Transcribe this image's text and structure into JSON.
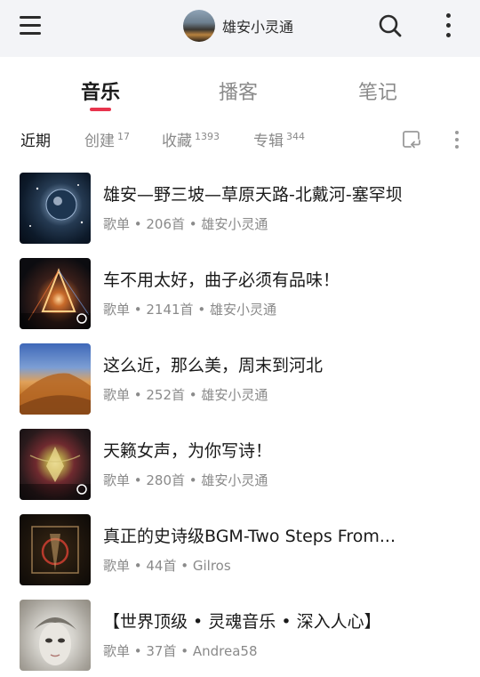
{
  "header": {
    "menu_icon": "hamburger-menu-icon",
    "username": "雄安小灵通",
    "search_icon": "search-icon",
    "more_icon": "more-vertical-icon"
  },
  "tabs": [
    {
      "label": "音乐",
      "active": true
    },
    {
      "label": "播客",
      "active": false
    },
    {
      "label": "笔记",
      "active": false
    }
  ],
  "accent_color": "#e8344d",
  "subtabs": [
    {
      "label": "近期",
      "count": "",
      "active": true
    },
    {
      "label": "创建",
      "count": "17",
      "active": false
    },
    {
      "label": "收藏",
      "count": "1393",
      "active": false
    },
    {
      "label": "专辑",
      "count": "344",
      "active": false
    }
  ],
  "subtab_icons": {
    "import": "import-playlist-icon",
    "more": "more-vertical-icon"
  },
  "playlists": [
    {
      "title": "雄安—野三坡—草原天路-北戴河-塞罕坝",
      "meta": "歌单 • 206首 • 雄安小灵通"
    },
    {
      "title": "车不用太好，曲子必须有品味！",
      "meta": "歌单 • 2141首 • 雄安小灵通"
    },
    {
      "title": "这么近，那么美，周末到河北",
      "meta": "歌单 • 252首 • 雄安小灵通"
    },
    {
      "title": "天籁女声，为你写诗！",
      "meta": "歌单 • 280首 • 雄安小灵通"
    },
    {
      "title": "真正的史诗级BGM-Two Steps From...",
      "meta": "歌单 • 44首 • Gilros"
    },
    {
      "title": "【世界顶级 • 灵魂音乐 • 深入人心】",
      "meta": "歌单 • 37首 • Andrea58"
    }
  ]
}
